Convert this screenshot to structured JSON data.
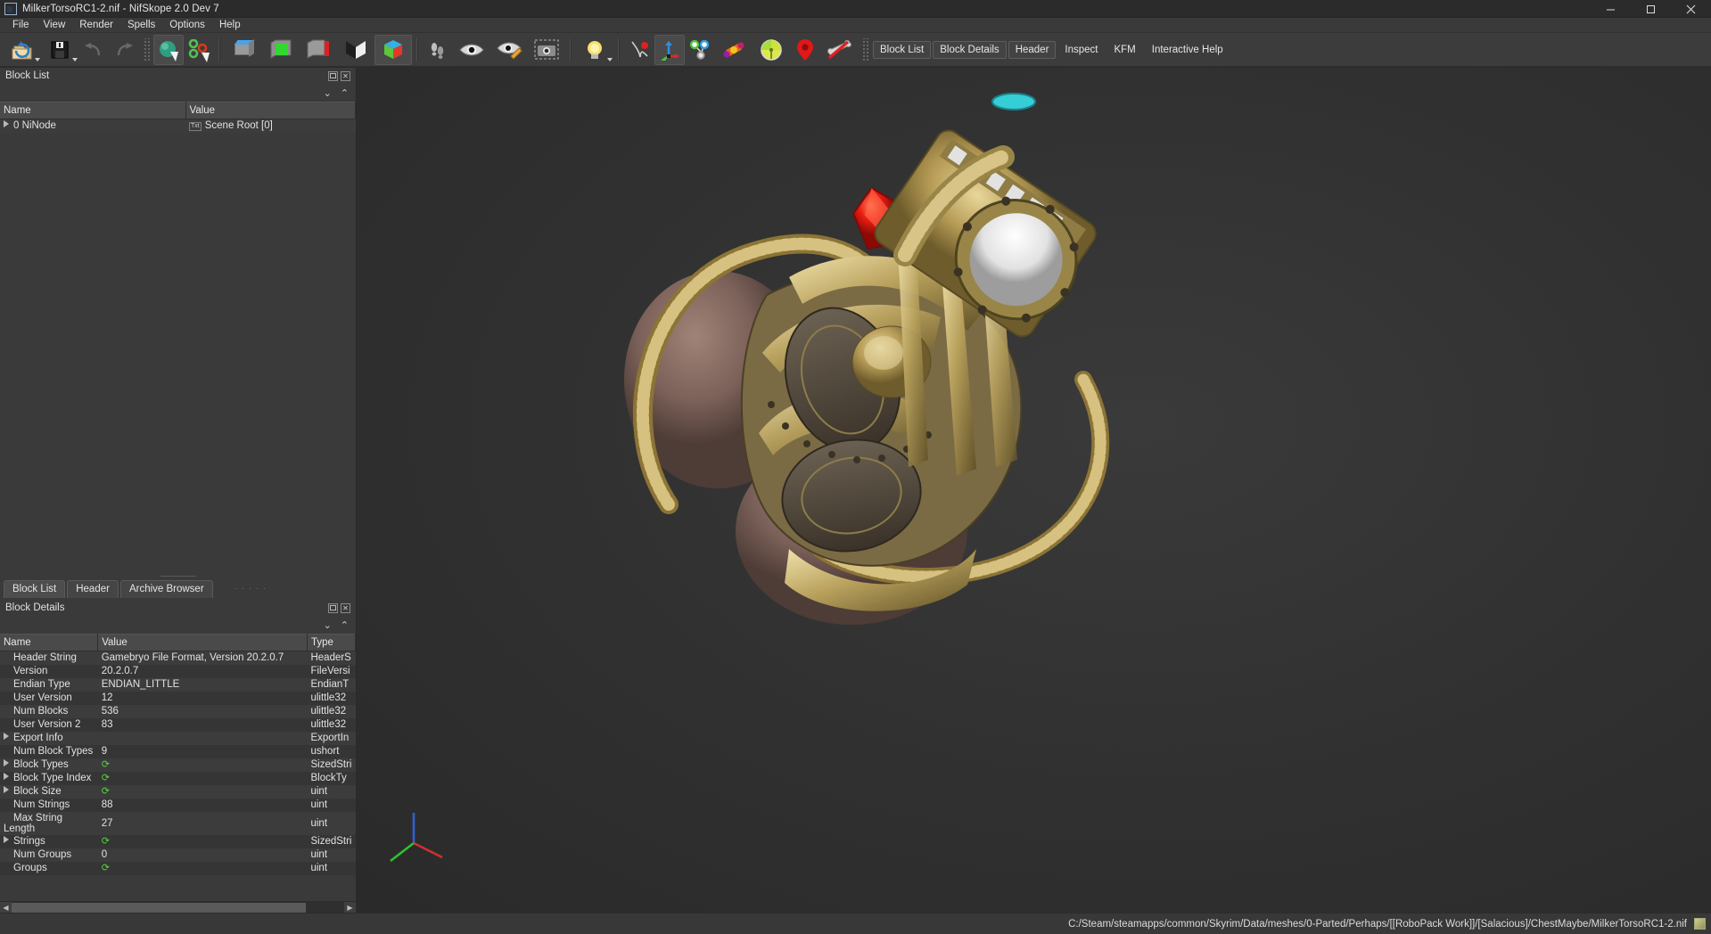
{
  "window": {
    "title": "MilkerTorsoRC1-2.nif - NifSkope 2.0 Dev 7",
    "icon": "nifskope-app-icon",
    "controls": {
      "minimize": "minimize-icon",
      "maximize": "maximize-icon",
      "close": "close-icon"
    }
  },
  "menu": {
    "items": [
      {
        "label": "File"
      },
      {
        "label": "View"
      },
      {
        "label": "Render"
      },
      {
        "label": "Spells"
      },
      {
        "label": "Options"
      },
      {
        "label": "Help"
      }
    ]
  },
  "toolbar": {
    "icons": [
      {
        "name": "open-file-icon",
        "state": "enabled"
      },
      {
        "name": "save-file-icon",
        "state": "enabled"
      },
      {
        "name": "undo-icon",
        "state": "disabled"
      },
      {
        "name": "redo-icon",
        "state": "disabled"
      },
      {
        "name": "select-object-icon",
        "state": "active"
      },
      {
        "name": "select-vertex-icon",
        "state": "enabled"
      },
      {
        "name": "view-top-icon",
        "state": "enabled"
      },
      {
        "name": "view-front-icon",
        "state": "enabled"
      },
      {
        "name": "view-side-icon",
        "state": "enabled"
      },
      {
        "name": "view-flip-icon",
        "state": "enabled"
      },
      {
        "name": "view-user-icon",
        "state": "active"
      },
      {
        "name": "walk-icon",
        "state": "enabled"
      },
      {
        "name": "show-hidden-icon",
        "state": "enabled"
      },
      {
        "name": "edit-visibility-icon",
        "state": "enabled"
      },
      {
        "name": "screenshot-icon",
        "state": "enabled"
      },
      {
        "name": "lighting-icon",
        "state": "enabled"
      },
      {
        "name": "draw-nodes-icon",
        "state": "enabled"
      },
      {
        "name": "draw-axes-icon",
        "state": "active"
      },
      {
        "name": "draw-havok-icon",
        "state": "enabled"
      },
      {
        "name": "draw-constraints-icon",
        "state": "enabled"
      },
      {
        "name": "draw-furniture-icon",
        "state": "enabled"
      },
      {
        "name": "draw-markers-icon",
        "state": "enabled"
      },
      {
        "name": "draw-bones-icon",
        "state": "enabled"
      }
    ],
    "buttons": [
      {
        "label": "Block List",
        "framed": true
      },
      {
        "label": "Block Details",
        "framed": true
      },
      {
        "label": "Header",
        "framed": true
      },
      {
        "label": "Inspect",
        "framed": false
      },
      {
        "label": "KFM",
        "framed": false
      },
      {
        "label": "Interactive Help",
        "framed": false
      }
    ]
  },
  "block_list": {
    "dock_title": "Block List",
    "columns": [
      "Name",
      "Value"
    ],
    "rows": [
      {
        "expander": true,
        "name": "0 NiNode",
        "value": "Scene Root [0]",
        "value_badge": "Txt"
      }
    ]
  },
  "panel_tabs": [
    {
      "label": "Block List",
      "active": true
    },
    {
      "label": "Header",
      "active": false
    },
    {
      "label": "Archive Browser",
      "active": false
    }
  ],
  "block_details": {
    "dock_title": "Block Details",
    "columns": [
      "Name",
      "Value",
      "Type"
    ],
    "rows": [
      {
        "expander": false,
        "name": "Header String",
        "value": "Gamebryo File Format, Version 20.2.0.7",
        "type": "HeaderS"
      },
      {
        "expander": false,
        "name": "Version",
        "value": "20.2.0.7",
        "type": "FileVersi"
      },
      {
        "expander": false,
        "name": "Endian Type",
        "value": "ENDIAN_LITTLE",
        "type": "EndianT"
      },
      {
        "expander": false,
        "name": "User Version",
        "value": "12",
        "type": "ulittle32"
      },
      {
        "expander": false,
        "name": "Num Blocks",
        "value": "536",
        "type": "ulittle32"
      },
      {
        "expander": false,
        "name": "User Version 2",
        "value": "83",
        "type": "ulittle32"
      },
      {
        "expander": true,
        "name": "Export Info",
        "value": "",
        "type": "ExportIn"
      },
      {
        "expander": false,
        "name": "Num Block Types",
        "value": "9",
        "type": "ushort"
      },
      {
        "expander": true,
        "name": "Block Types",
        "value": "refresh",
        "type": "SizedStri"
      },
      {
        "expander": true,
        "name": "Block Type Index",
        "value": "refresh",
        "type": "BlockTy"
      },
      {
        "expander": true,
        "name": "Block Size",
        "value": "refresh",
        "type": "uint"
      },
      {
        "expander": false,
        "name": "Num Strings",
        "value": "88",
        "type": "uint"
      },
      {
        "expander": false,
        "name": "Max String Length",
        "value": "27",
        "type": "uint"
      },
      {
        "expander": true,
        "name": "Strings",
        "value": "refresh",
        "type": "SizedStri"
      },
      {
        "expander": false,
        "name": "Num Groups",
        "value": "0",
        "type": "uint"
      },
      {
        "expander": false,
        "name": "Groups",
        "value": "refresh",
        "type": "uint"
      }
    ]
  },
  "viewport": {
    "name": "3d-render-view",
    "axes_gizmo": {
      "x_color": "#d03030",
      "y_color": "#30c030",
      "z_color": "#3060d0"
    },
    "model_description": "Steampunk brass robotic torso mesh with red gem and white sphere"
  },
  "status": {
    "path": "C:/Steam/steamapps/common/Skyrim/Data/meshes/0-Parted/Perhaps/[[RoboPack Work]]/[Salacious]/ChestMaybe/MilkerTorsoRC1-2.nif",
    "icon": "file-type-icon"
  },
  "colors": {
    "window_bg": "#2b2b2b",
    "panel_bg": "#3a3a3a",
    "header_bg": "#4a4a4a",
    "text": "#e6e6e6",
    "accent_green": "#57d33a",
    "gem_red": "#e81c1c"
  }
}
